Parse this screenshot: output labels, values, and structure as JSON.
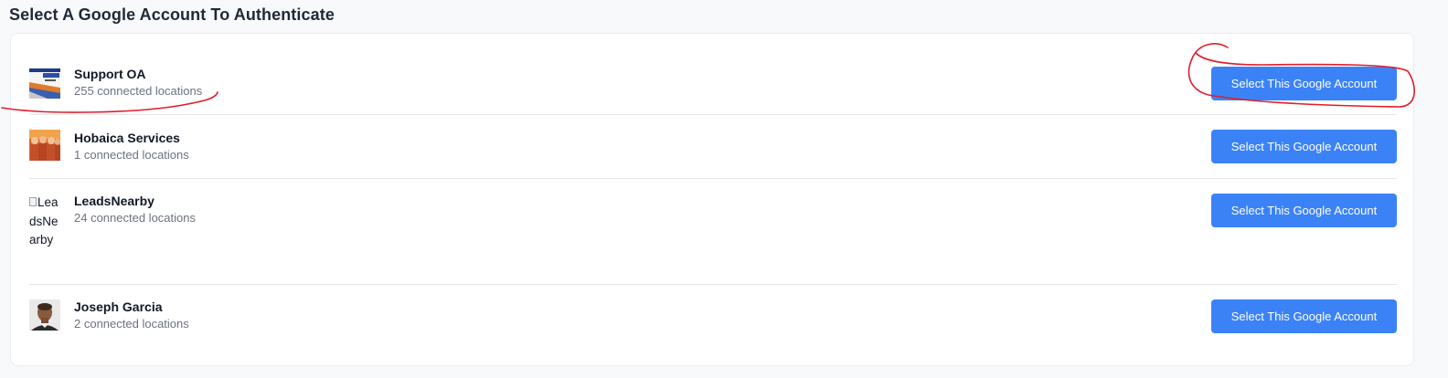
{
  "page": {
    "title": "Select A Google Account To Authenticate"
  },
  "accounts": [
    {
      "name": "Support OA",
      "locations": "255 connected locations",
      "button_label": "Select This Google Account",
      "avatar": "business-card-thumbnail"
    },
    {
      "name": "Hobaica Services",
      "locations": "1 connected locations",
      "button_label": "Select This Google Account",
      "avatar": "team-photo-thumbnail"
    },
    {
      "name": "LeadsNearby",
      "locations": "24 connected locations",
      "button_label": "Select This Google Account",
      "avatar": "broken-image",
      "avatar_alt": "LeadsNearby"
    },
    {
      "name": "Joseph Garcia",
      "locations": "2 connected locations",
      "button_label": "Select This Google Account",
      "avatar": "person-photo-thumbnail"
    }
  ],
  "colors": {
    "primary_button": "#3b82f6",
    "annotation": "#e11d2a"
  }
}
